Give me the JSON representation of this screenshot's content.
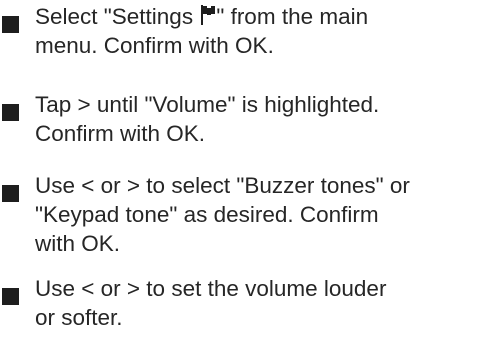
{
  "steps": [
    {
      "lines": [
        "Select \"Settings ",
        "\" from the main",
        "menu. Confirm with OK."
      ],
      "icon": "settings-flag-icon"
    },
    {
      "lines": [
        "Tap > until \"Volume\" is highlighted.",
        "Confirm with OK."
      ]
    },
    {
      "lines": [
        "Use < or > to select \"Buzzer tones\" or",
        "\"Keypad tone\" as desired. Confirm",
        "with OK."
      ]
    },
    {
      "lines": [
        "Use < or > to set the volume louder",
        "or softer."
      ]
    }
  ],
  "colors": {
    "text": "#262626",
    "bullet": "#1e1e1e"
  }
}
